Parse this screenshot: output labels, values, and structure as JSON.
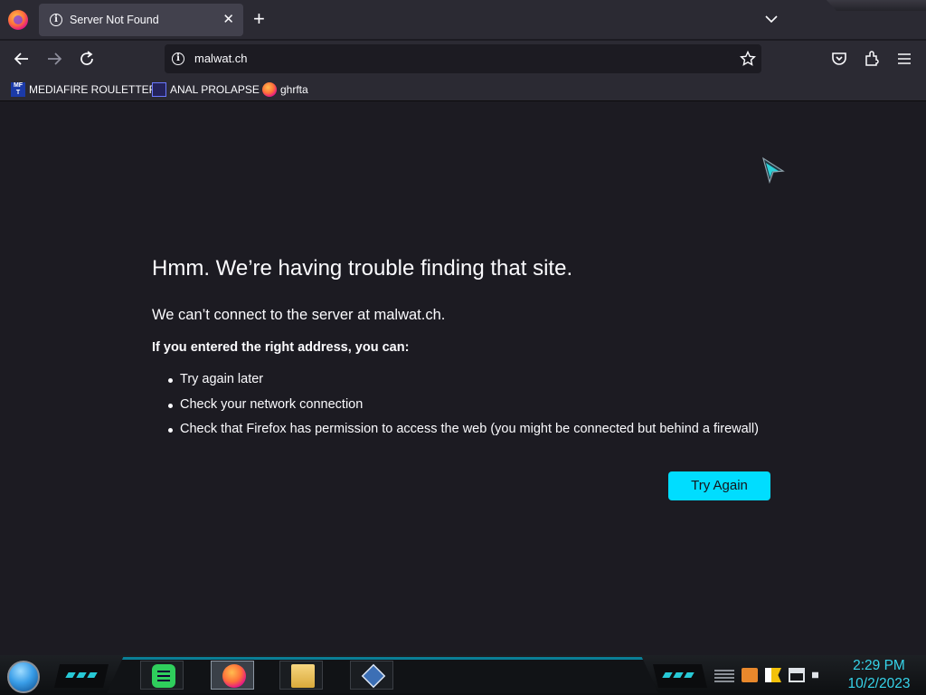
{
  "browser": {
    "tab": {
      "title": "Server Not Found",
      "close_glyph": "✕"
    },
    "new_tab_glyph": "+",
    "address_bar": {
      "url": "malwat.ch",
      "site_info_glyph": "i"
    },
    "bookmarks": [
      {
        "label": "MEDIAFIRE ROULETTER",
        "icon_text": "MF T",
        "icon": "mediafire-icon"
      },
      {
        "label": "ANAL PROLAPSE",
        "icon": "sigma-icon"
      },
      {
        "label": "ghrfta",
        "icon": "firefox-icon"
      }
    ],
    "toolbar_icons": [
      "back-icon",
      "forward-icon",
      "reload-icon",
      "bookmark-star-icon",
      "pocket-icon",
      "extensions-icon",
      "menu-icon"
    ]
  },
  "error_page": {
    "title": "Hmm. We’re having trouble finding that site.",
    "subtitle": "We can’t connect to the server at malwat.ch.",
    "lead": "If you entered the right address, you can:",
    "suggestions": [
      "Try again later",
      "Check your network connection",
      "Check that Firefox has permission to access the web (you might be connected but behind a firewall)"
    ],
    "button_label": "Try Again",
    "accent_color": "#00ddff",
    "background_color": "#1c1b22"
  },
  "taskbar": {
    "apps": [
      "notes-icon",
      "firefox-icon",
      "file-explorer-icon",
      "virtualbox-icon"
    ],
    "active_app": "firefox-icon",
    "clock": {
      "time": "2:29 PM",
      "date": "10/2/2023"
    },
    "clock_color": "#36d4ea"
  }
}
